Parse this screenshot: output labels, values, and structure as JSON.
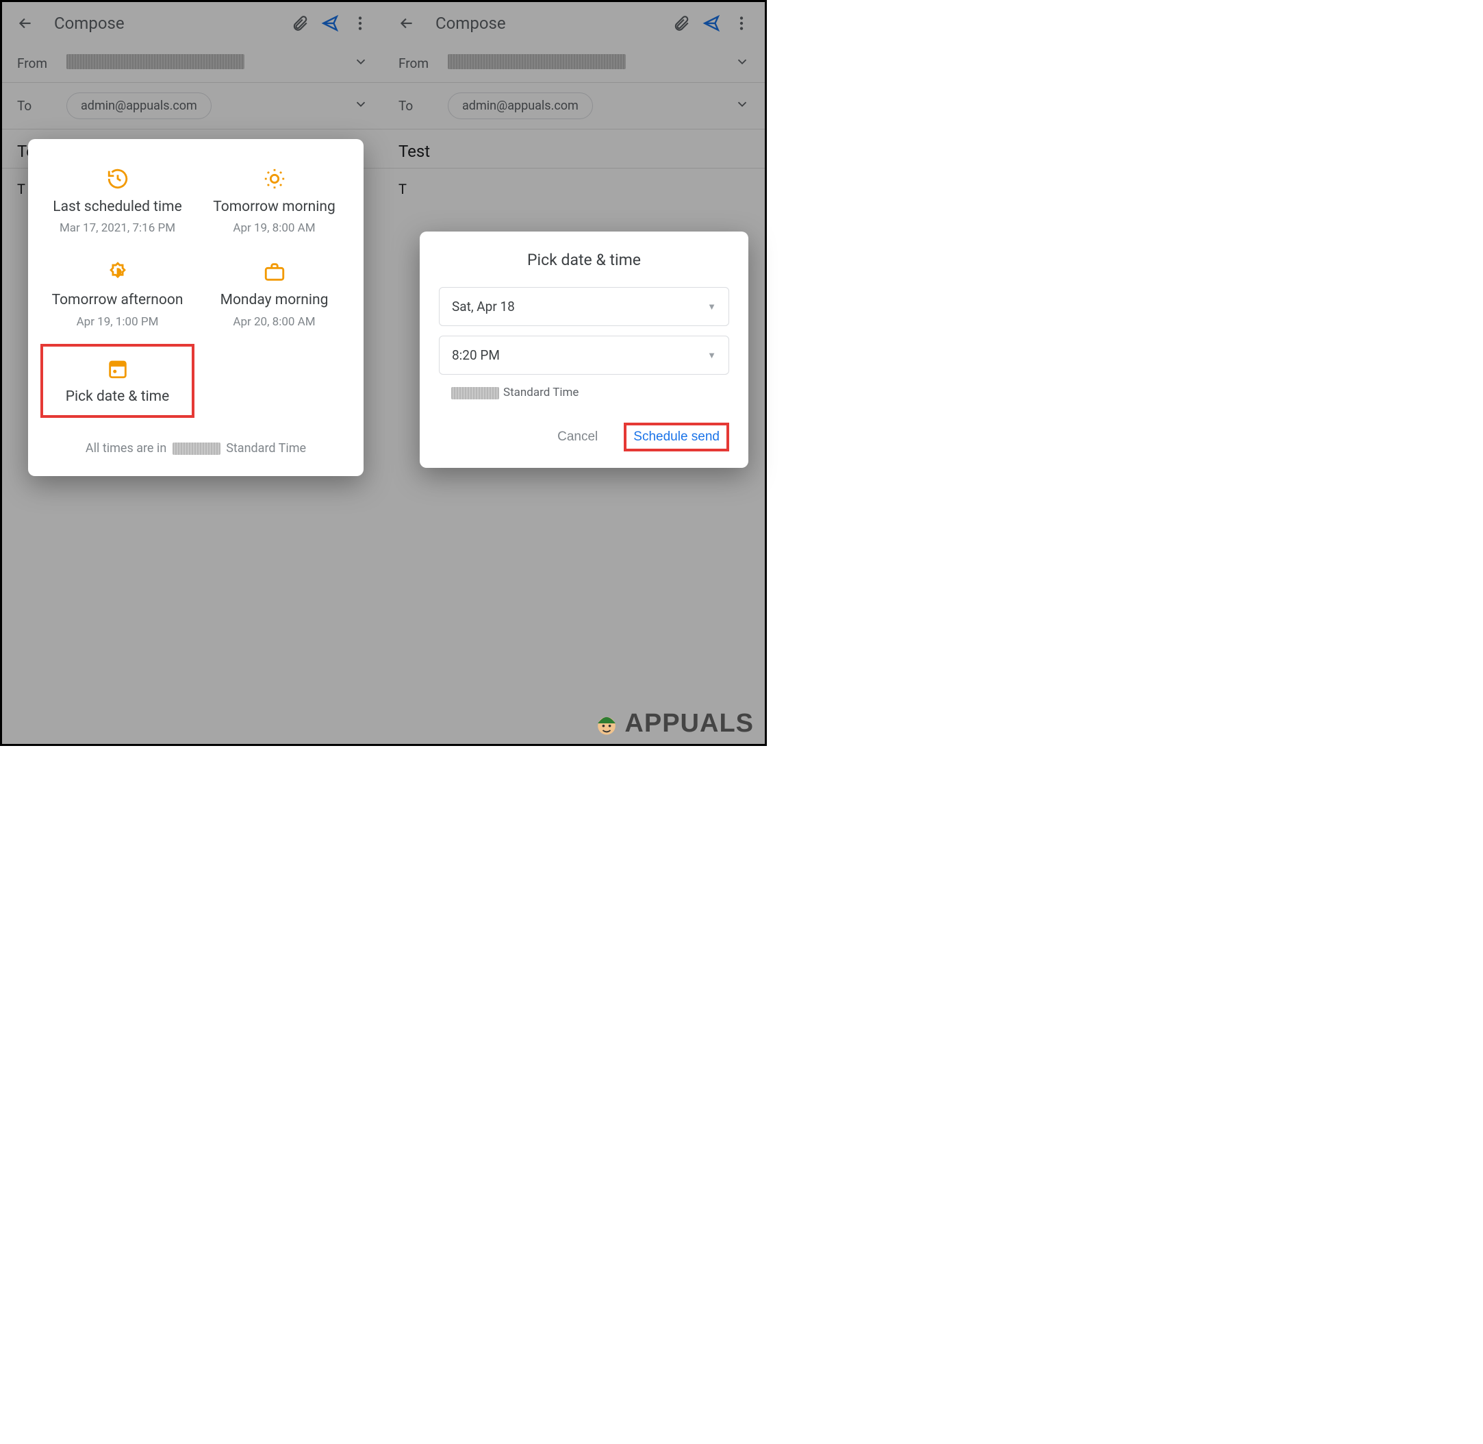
{
  "compose": {
    "title": "Compose",
    "from_label": "From",
    "to_label": "To",
    "to_value": "admin@appuals.com",
    "subject": "Test",
    "body_initial": "T"
  },
  "schedule_modal": {
    "options": [
      {
        "title": "Last scheduled time",
        "sub": "Mar 17, 2021, 7:16 PM"
      },
      {
        "title": "Tomorrow morning",
        "sub": "Apr 19, 8:00 AM"
      },
      {
        "title": "Tomorrow afternoon",
        "sub": "Apr 19, 1:00 PM"
      },
      {
        "title": "Monday morning",
        "sub": "Apr 20, 8:00 AM"
      },
      {
        "title": "Pick date & time",
        "sub": ""
      }
    ],
    "footnote_prefix": "All times are in",
    "footnote_suffix": "Standard Time"
  },
  "pick_modal": {
    "title": "Pick date & time",
    "date_value": "Sat, Apr 18",
    "time_value": "8:20 PM",
    "tz_suffix": "Standard Time",
    "cancel": "Cancel",
    "confirm": "Schedule send"
  },
  "watermark": "APPUALS"
}
